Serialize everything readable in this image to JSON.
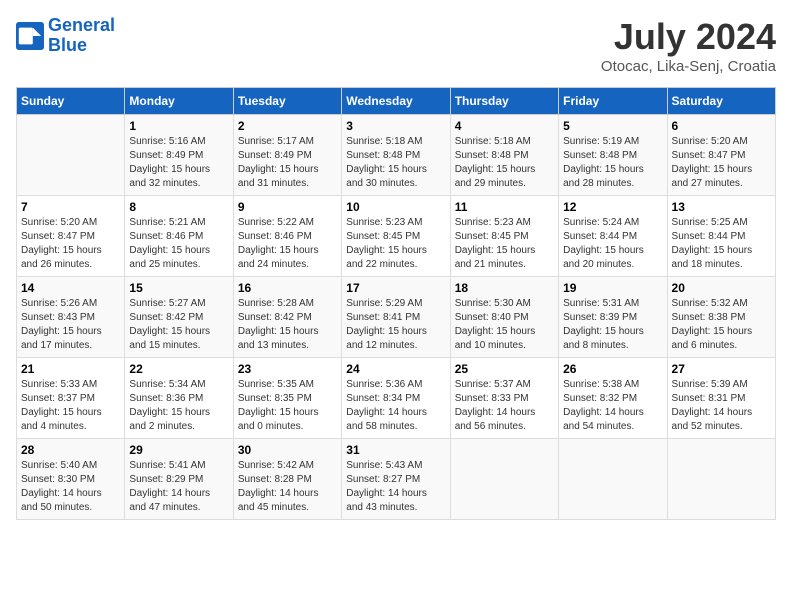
{
  "logo": {
    "line1": "General",
    "line2": "Blue"
  },
  "header": {
    "month": "July 2024",
    "location": "Otocac, Lika-Senj, Croatia"
  },
  "weekdays": [
    "Sunday",
    "Monday",
    "Tuesday",
    "Wednesday",
    "Thursday",
    "Friday",
    "Saturday"
  ],
  "weeks": [
    [
      {
        "day": "",
        "info": ""
      },
      {
        "day": "1",
        "info": "Sunrise: 5:16 AM\nSunset: 8:49 PM\nDaylight: 15 hours\nand 32 minutes."
      },
      {
        "day": "2",
        "info": "Sunrise: 5:17 AM\nSunset: 8:49 PM\nDaylight: 15 hours\nand 31 minutes."
      },
      {
        "day": "3",
        "info": "Sunrise: 5:18 AM\nSunset: 8:48 PM\nDaylight: 15 hours\nand 30 minutes."
      },
      {
        "day": "4",
        "info": "Sunrise: 5:18 AM\nSunset: 8:48 PM\nDaylight: 15 hours\nand 29 minutes."
      },
      {
        "day": "5",
        "info": "Sunrise: 5:19 AM\nSunset: 8:48 PM\nDaylight: 15 hours\nand 28 minutes."
      },
      {
        "day": "6",
        "info": "Sunrise: 5:20 AM\nSunset: 8:47 PM\nDaylight: 15 hours\nand 27 minutes."
      }
    ],
    [
      {
        "day": "7",
        "info": "Sunrise: 5:20 AM\nSunset: 8:47 PM\nDaylight: 15 hours\nand 26 minutes."
      },
      {
        "day": "8",
        "info": "Sunrise: 5:21 AM\nSunset: 8:46 PM\nDaylight: 15 hours\nand 25 minutes."
      },
      {
        "day": "9",
        "info": "Sunrise: 5:22 AM\nSunset: 8:46 PM\nDaylight: 15 hours\nand 24 minutes."
      },
      {
        "day": "10",
        "info": "Sunrise: 5:23 AM\nSunset: 8:45 PM\nDaylight: 15 hours\nand 22 minutes."
      },
      {
        "day": "11",
        "info": "Sunrise: 5:23 AM\nSunset: 8:45 PM\nDaylight: 15 hours\nand 21 minutes."
      },
      {
        "day": "12",
        "info": "Sunrise: 5:24 AM\nSunset: 8:44 PM\nDaylight: 15 hours\nand 20 minutes."
      },
      {
        "day": "13",
        "info": "Sunrise: 5:25 AM\nSunset: 8:44 PM\nDaylight: 15 hours\nand 18 minutes."
      }
    ],
    [
      {
        "day": "14",
        "info": "Sunrise: 5:26 AM\nSunset: 8:43 PM\nDaylight: 15 hours\nand 17 minutes."
      },
      {
        "day": "15",
        "info": "Sunrise: 5:27 AM\nSunset: 8:42 PM\nDaylight: 15 hours\nand 15 minutes."
      },
      {
        "day": "16",
        "info": "Sunrise: 5:28 AM\nSunset: 8:42 PM\nDaylight: 15 hours\nand 13 minutes."
      },
      {
        "day": "17",
        "info": "Sunrise: 5:29 AM\nSunset: 8:41 PM\nDaylight: 15 hours\nand 12 minutes."
      },
      {
        "day": "18",
        "info": "Sunrise: 5:30 AM\nSunset: 8:40 PM\nDaylight: 15 hours\nand 10 minutes."
      },
      {
        "day": "19",
        "info": "Sunrise: 5:31 AM\nSunset: 8:39 PM\nDaylight: 15 hours\nand 8 minutes."
      },
      {
        "day": "20",
        "info": "Sunrise: 5:32 AM\nSunset: 8:38 PM\nDaylight: 15 hours\nand 6 minutes."
      }
    ],
    [
      {
        "day": "21",
        "info": "Sunrise: 5:33 AM\nSunset: 8:37 PM\nDaylight: 15 hours\nand 4 minutes."
      },
      {
        "day": "22",
        "info": "Sunrise: 5:34 AM\nSunset: 8:36 PM\nDaylight: 15 hours\nand 2 minutes."
      },
      {
        "day": "23",
        "info": "Sunrise: 5:35 AM\nSunset: 8:35 PM\nDaylight: 15 hours\nand 0 minutes."
      },
      {
        "day": "24",
        "info": "Sunrise: 5:36 AM\nSunset: 8:34 PM\nDaylight: 14 hours\nand 58 minutes."
      },
      {
        "day": "25",
        "info": "Sunrise: 5:37 AM\nSunset: 8:33 PM\nDaylight: 14 hours\nand 56 minutes."
      },
      {
        "day": "26",
        "info": "Sunrise: 5:38 AM\nSunset: 8:32 PM\nDaylight: 14 hours\nand 54 minutes."
      },
      {
        "day": "27",
        "info": "Sunrise: 5:39 AM\nSunset: 8:31 PM\nDaylight: 14 hours\nand 52 minutes."
      }
    ],
    [
      {
        "day": "28",
        "info": "Sunrise: 5:40 AM\nSunset: 8:30 PM\nDaylight: 14 hours\nand 50 minutes."
      },
      {
        "day": "29",
        "info": "Sunrise: 5:41 AM\nSunset: 8:29 PM\nDaylight: 14 hours\nand 47 minutes."
      },
      {
        "day": "30",
        "info": "Sunrise: 5:42 AM\nSunset: 8:28 PM\nDaylight: 14 hours\nand 45 minutes."
      },
      {
        "day": "31",
        "info": "Sunrise: 5:43 AM\nSunset: 8:27 PM\nDaylight: 14 hours\nand 43 minutes."
      },
      {
        "day": "",
        "info": ""
      },
      {
        "day": "",
        "info": ""
      },
      {
        "day": "",
        "info": ""
      }
    ]
  ]
}
